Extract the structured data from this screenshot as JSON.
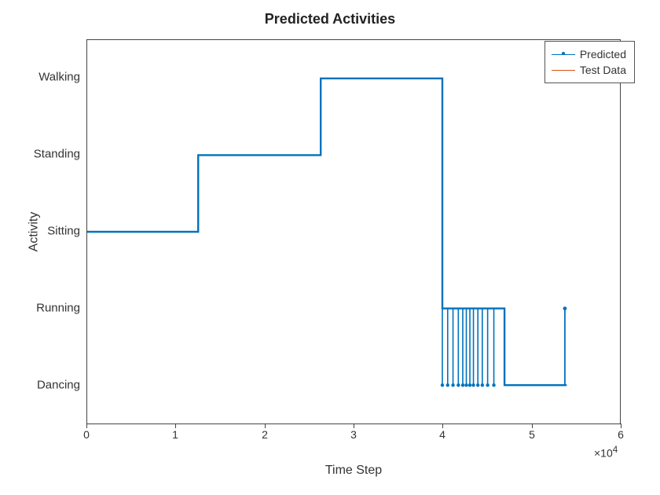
{
  "chart_data": {
    "type": "line",
    "title": "Predicted Activities",
    "xlabel": "Time Step",
    "ylabel": "Activity",
    "xlim": [
      0,
      60000
    ],
    "x_exponent_label": "×10",
    "x_exponent_power": "4",
    "x_ticks": [
      0,
      10000,
      20000,
      30000,
      40000,
      50000,
      60000
    ],
    "x_tick_labels": [
      "0",
      "1",
      "2",
      "3",
      "4",
      "5",
      "6"
    ],
    "y_categories": [
      "Dancing",
      "Running",
      "Sitting",
      "Standing",
      "Walking"
    ],
    "series": [
      {
        "name": "Predicted",
        "color": "#0072BD",
        "marker": "dot",
        "segments": [
          {
            "x": [
              0,
              12500
            ],
            "cat": "Sitting"
          },
          {
            "x": [
              12500,
              26300
            ],
            "cat": "Standing"
          },
          {
            "x": [
              26300,
              40000
            ],
            "cat": "Walking"
          },
          {
            "x": [
              40000,
              47000
            ],
            "cat": "Running"
          },
          {
            "x": [
              47000,
              54000
            ],
            "cat": "Dancing"
          }
        ],
        "spikes_to_dancing_x": [
          40000,
          40600,
          41200,
          41800,
          42300,
          42700,
          43100,
          43500,
          44000,
          44500,
          45100,
          45800
        ],
        "final_spike_to_running_x": 53800
      },
      {
        "name": "Test Data",
        "color": "#D95319",
        "segments": [
          {
            "x": [
              0,
              12500
            ],
            "cat": "Sitting"
          },
          {
            "x": [
              12500,
              26300
            ],
            "cat": "Standing"
          },
          {
            "x": [
              26300,
              40000
            ],
            "cat": "Walking"
          },
          {
            "x": [
              40000,
              47000
            ],
            "cat": "Running"
          },
          {
            "x": [
              47000,
              54000
            ],
            "cat": "Dancing"
          }
        ]
      }
    ],
    "legend": {
      "position": "northeast",
      "entries": [
        "Predicted",
        "Test Data"
      ]
    }
  }
}
